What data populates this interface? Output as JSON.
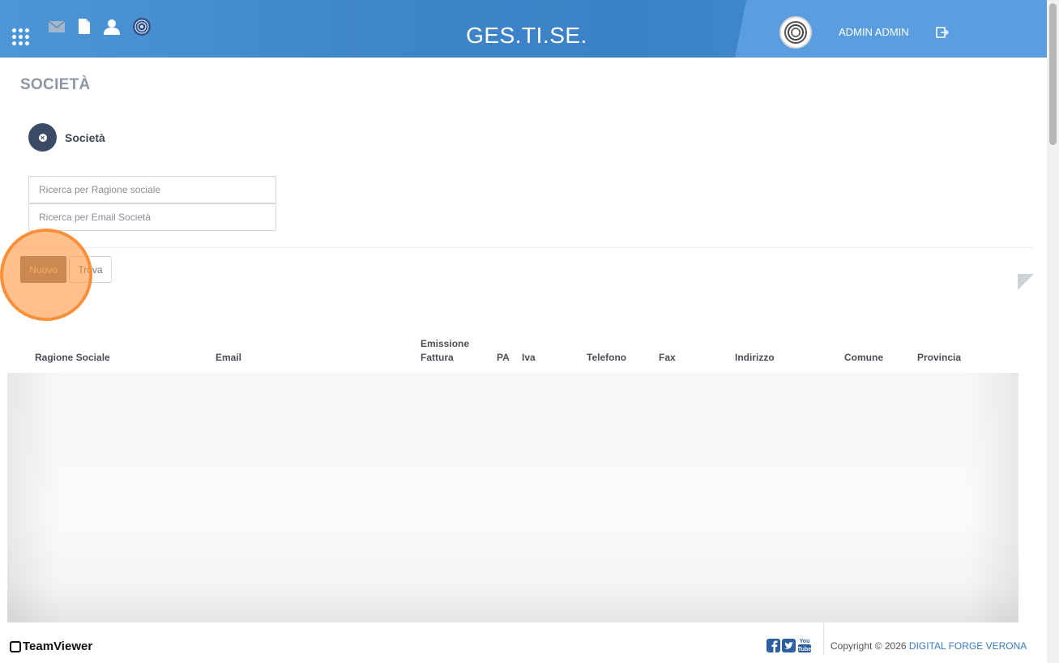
{
  "header": {
    "app_title": "GES.TI.SE.",
    "user_name": "ADMIN ADMIN",
    "icons": [
      "apps-grid-icon",
      "mail-icon",
      "document-icon",
      "user-icon",
      "fingerprint-icon",
      "logout-icon"
    ]
  },
  "page": {
    "title": "SOCIETÀ",
    "section_label": "Società"
  },
  "search": {
    "ragione_sociale_placeholder": "Ricerca per Ragione sociale",
    "email_placeholder": "Ricerca per Email Società"
  },
  "actions": {
    "new_label": "Nuovo",
    "find_label": "Trova"
  },
  "table": {
    "columns": [
      "Ragione Sociale",
      "Email",
      "Emissione Fattura",
      "PA",
      "Iva",
      "Telefono",
      "Fax",
      "Indirizzo",
      "Comune",
      "Provincia"
    ],
    "rows": []
  },
  "footer": {
    "teamviewer": "TeamViewer",
    "copyright_prefix": "Copyright © 2026",
    "copyright_link": "DIGITAL FORGE VERONA",
    "social": [
      "facebook-icon",
      "twitter-icon",
      "youtube-icon"
    ]
  },
  "colors": {
    "header_blue": "#3f86c8",
    "accent_orange": "#f78c32",
    "new_button": "#8e8478"
  }
}
